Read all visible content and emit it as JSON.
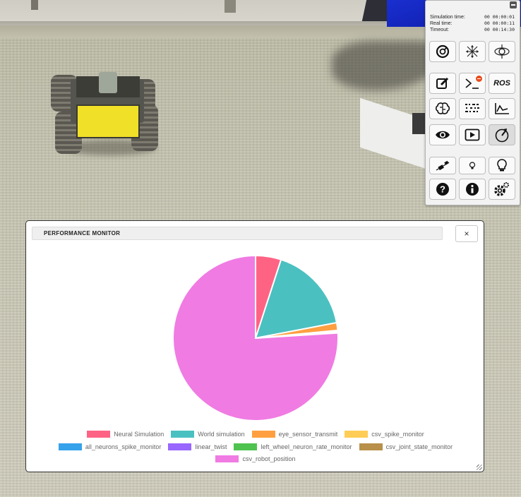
{
  "toolbar": {
    "times": [
      {
        "label": "Simulation time:",
        "value": "00 00:00:01"
      },
      {
        "label": "Real time:",
        "value": "00 00:00:11"
      },
      {
        "label": "Timeout:",
        "value": "00 00:14:30"
      }
    ],
    "ros_label": "ROS",
    "icons": [
      "reset-view-icon",
      "fullscreen-icon",
      "camera-orbit-icon",
      "edit-icon",
      "terminal-icon",
      "ros-icon",
      "brain-icon",
      "spike-raster-icon",
      "plot-icon",
      "eye-icon",
      "play-icon",
      "performance-icon",
      "slider-icon",
      "bulb-small-icon",
      "bulb-large-icon",
      "help-icon",
      "info-icon",
      "settings-icon"
    ]
  },
  "monitor": {
    "title": "PERFORMANCE MONITOR",
    "close_label": "×"
  },
  "chart_data": {
    "type": "pie",
    "labels": [
      "Neural Simulation",
      "World simulation",
      "eye_sensor_transmit",
      "csv_spike_monitor",
      "all_neurons_spike_monitor",
      "linear_twist",
      "left_wheel_neuron_rate_monitor",
      "csv_joint_state_monitor",
      "csv_robot_position"
    ],
    "values": [
      5.0,
      17.0,
      1.5,
      0.1,
      0.1,
      0.1,
      0.1,
      0.1,
      76.0
    ],
    "colors": [
      "#ff6384",
      "#4bc0c0",
      "#ff9f40",
      "#ffcd56",
      "#36a2eb",
      "#9966ff",
      "#4fc34f",
      "#b8904a",
      "#f07be3"
    ],
    "legend_position": "bottom"
  }
}
